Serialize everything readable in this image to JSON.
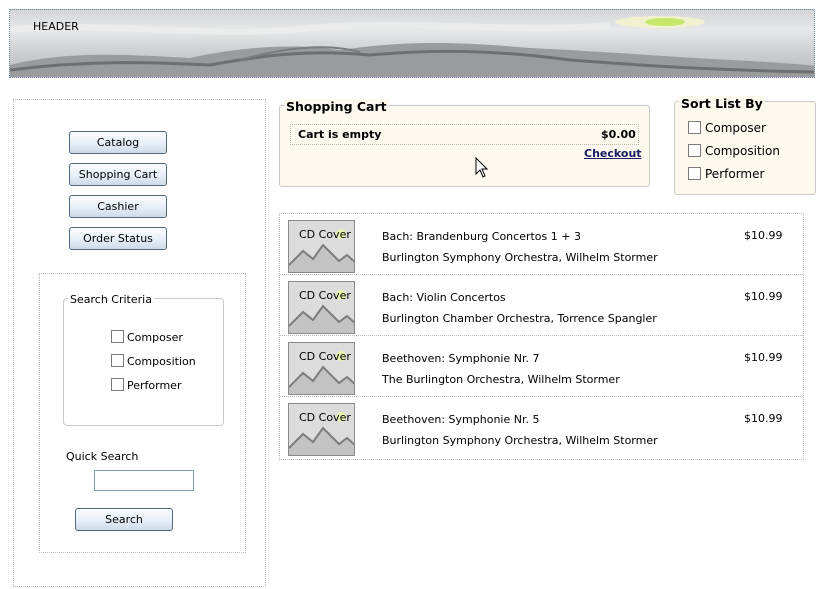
{
  "header": {
    "title": "HEADER"
  },
  "nav": {
    "buttons": [
      {
        "label": "Catalog"
      },
      {
        "label": "Shopping Cart"
      },
      {
        "label": "Cashier"
      },
      {
        "label": "Order Status"
      }
    ]
  },
  "search": {
    "legend": "Search Criteria",
    "options": [
      {
        "label": "Composer",
        "checked": false
      },
      {
        "label": "Composition",
        "checked": false
      },
      {
        "label": "Performer",
        "checked": false
      }
    ],
    "quick_label": "Quick Search",
    "quick_value": "",
    "button_label": "Search"
  },
  "cart": {
    "title": "Shopping Cart",
    "status": "Cart is empty",
    "total": "$0.00",
    "checkout_label": "Checkout"
  },
  "sort": {
    "title": "Sort List By",
    "options": [
      {
        "label": "Composer",
        "checked": false
      },
      {
        "label": "Composition",
        "checked": false
      },
      {
        "label": "Performer",
        "checked": false
      }
    ]
  },
  "products": [
    {
      "cover": "CD Cover",
      "title": "Bach: Brandenburg Concertos 1 + 3",
      "artist": "Burlington Symphony Orchestra, Wilhelm Stormer",
      "price": "$10.99"
    },
    {
      "cover": "CD Cover",
      "title": "Bach: Violin Concertos",
      "artist": "Burlington Chamber Orchestra, Torrence Spangler",
      "price": "$10.99"
    },
    {
      "cover": "CD Cover",
      "title": "Beethoven: Symphonie Nr. 7",
      "artist": "The Burlington Orchestra, Wilhelm Stormer",
      "price": "$10.99"
    },
    {
      "cover": "CD Cover",
      "title": "Beethoven: Symphonie Nr. 5",
      "artist": "Burlington Symphony Orchestra, Wilhelm Stormer",
      "price": "$10.99"
    }
  ],
  "colors": {
    "panel_bg": "#fdf9ef",
    "link": "#151b63",
    "button_border": "#4f6781"
  },
  "icons": {
    "cursor": "mouse-pointer-icon",
    "cover_art": "mountain-landscape-icon"
  }
}
